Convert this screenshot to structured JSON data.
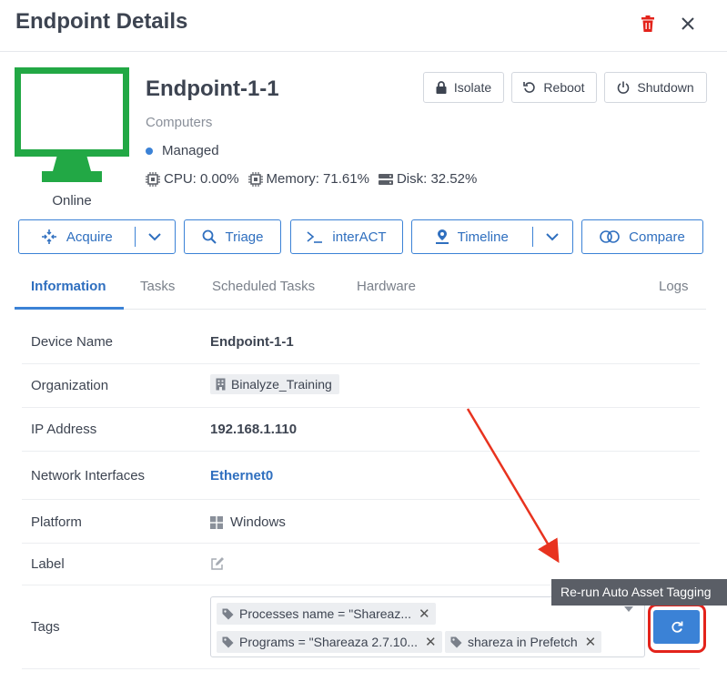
{
  "header": {
    "title": "Endpoint Details",
    "delete_icon": "trash-icon",
    "close_icon": "close-icon"
  },
  "endpoint": {
    "name": "Endpoint-1-1",
    "type": "Computers",
    "managed": "Managed",
    "status": "Online",
    "status_color": "#22a845",
    "stats": {
      "cpu": "CPU: 0.00%",
      "memory": "Memory: 71.61%",
      "disk": "Disk: 32.52%"
    }
  },
  "top_actions": {
    "isolate": "Isolate",
    "reboot": "Reboot",
    "shutdown": "Shutdown"
  },
  "actions": {
    "acquire": "Acquire",
    "triage": "Triage",
    "interact": "interACT",
    "timeline": "Timeline",
    "compare": "Compare"
  },
  "tabs": [
    "Information",
    "Tasks",
    "Scheduled Tasks",
    "Hardware",
    "Logs"
  ],
  "info": {
    "device_name_label": "Device Name",
    "device_name": "Endpoint-1-1",
    "organization_label": "Organization",
    "organization": "Binalyze_Training",
    "ip_label": "IP Address",
    "ip": "192.168.1.110",
    "network_label": "Network Interfaces",
    "network": "Ethernet0",
    "platform_label": "Platform",
    "platform": "Windows",
    "label_label": "Label",
    "tags_label": "Tags",
    "tags": [
      "Processes name = \"Shareaz...",
      "Programs = \"Shareaza 2.7.10...",
      "shareza in Prefetch"
    ]
  },
  "tooltip": "Re-run Auto Asset Tagging",
  "colors": {
    "accent": "#3b82d6",
    "danger": "#e3231b",
    "annotation": "#e8331f"
  }
}
